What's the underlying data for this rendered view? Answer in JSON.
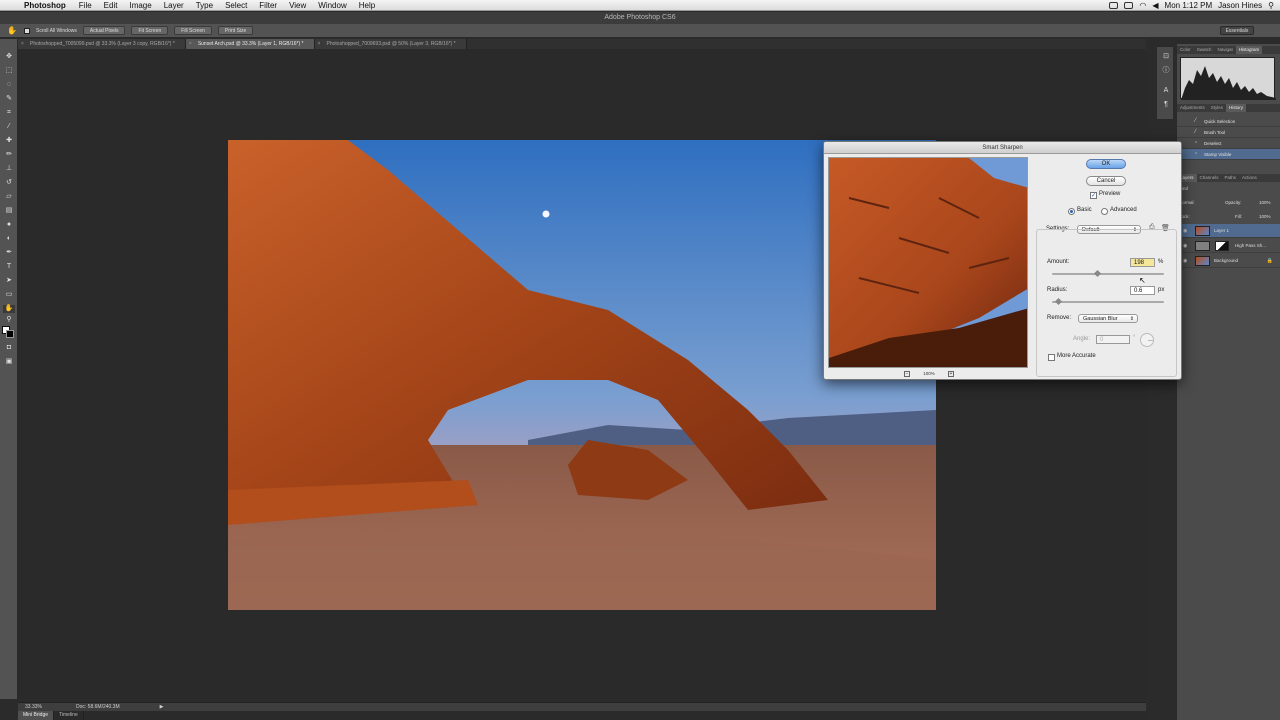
{
  "menubar": {
    "app_name": "Photoshop",
    "items": [
      "File",
      "Edit",
      "Image",
      "Layer",
      "Type",
      "Select",
      "Filter",
      "View",
      "Window",
      "Help"
    ],
    "status_icons": [
      "ps-icon",
      "battery-icon",
      "wifi-icon",
      "volume-icon"
    ],
    "clock": "Mon 1:12 PM",
    "user": "Jason Hines"
  },
  "window": {
    "title": "Adobe Photoshop CS6"
  },
  "options_bar": {
    "scroll_all_windows": "Scroll All Windows",
    "buttons": [
      "Actual Pixels",
      "Fit Screen",
      "Fill Screen",
      "Print Size"
    ],
    "workspace": "Essentials"
  },
  "documents": {
    "tabs": [
      {
        "label": "Photoshopped_7005099.psd @ 33.3% (Layer 3 copy, RGB/16*) *",
        "active": false
      },
      {
        "label": "Sunset Arch.psd @ 33.3% (Layer 1, RGB/16*) *",
        "active": true
      },
      {
        "label": "Photoshopped_7009693.psd @ 50% (Layer 3, RGB/16*) *",
        "active": false
      }
    ]
  },
  "statusbar": {
    "zoom": "33.33%",
    "doc_info": "Doc: 58.6M/240.3M",
    "tabs": [
      "Mini Bridge",
      "Timeline"
    ]
  },
  "panels": {
    "top_tabs": [
      "Color",
      "Swatch",
      "Navigat",
      "Histogram"
    ],
    "history_tabs": [
      "Adjustments",
      "Styles",
      "History"
    ],
    "history": [
      {
        "label": "Quick Selection",
        "active": false
      },
      {
        "label": "Brush Tool",
        "active": false
      },
      {
        "label": "Deselect",
        "active": false
      },
      {
        "label": "Stamp Visible",
        "active": true
      }
    ],
    "layers_tabs": [
      "Layers",
      "Channels",
      "Paths",
      "Actions"
    ],
    "kind_label": "Kind",
    "blend_mode": "Normal",
    "opacity_label": "Opacity:",
    "opacity_value": "100%",
    "lock_label": "Lock:",
    "fill_label": "Fill:",
    "fill_value": "100%",
    "layers": [
      {
        "name": "Layer 1",
        "active": true
      },
      {
        "name": "High Pass Sh...",
        "active": false
      },
      {
        "name": "Background",
        "active": false
      }
    ]
  },
  "dialog": {
    "title": "Smart Sharpen",
    "ok_label": "OK",
    "cancel_label": "Cancel",
    "preview_label": "Preview",
    "preview_checked": true,
    "mode_basic": "Basic",
    "mode_advanced": "Advanced",
    "selected_mode": "Basic",
    "settings_label": "Settings:",
    "settings_value": "Default",
    "amount_label": "Amount:",
    "amount_value": "198",
    "amount_unit": "%",
    "amount_fraction": 0.4,
    "radius_label": "Radius:",
    "radius_value": "0.6",
    "radius_unit": "px",
    "radius_fraction": 0.05,
    "remove_label": "Remove:",
    "remove_value": "Gaussian Blur",
    "angle_label": "Angle:",
    "angle_value": "0",
    "angle_unit": "°",
    "more_accurate_label": "More Accurate",
    "more_accurate_checked": false,
    "preview_zoom": "100%"
  },
  "colors": {
    "accent": "#69a3e8",
    "selection": "#506b8f",
    "highlight": "#f5e79a"
  }
}
